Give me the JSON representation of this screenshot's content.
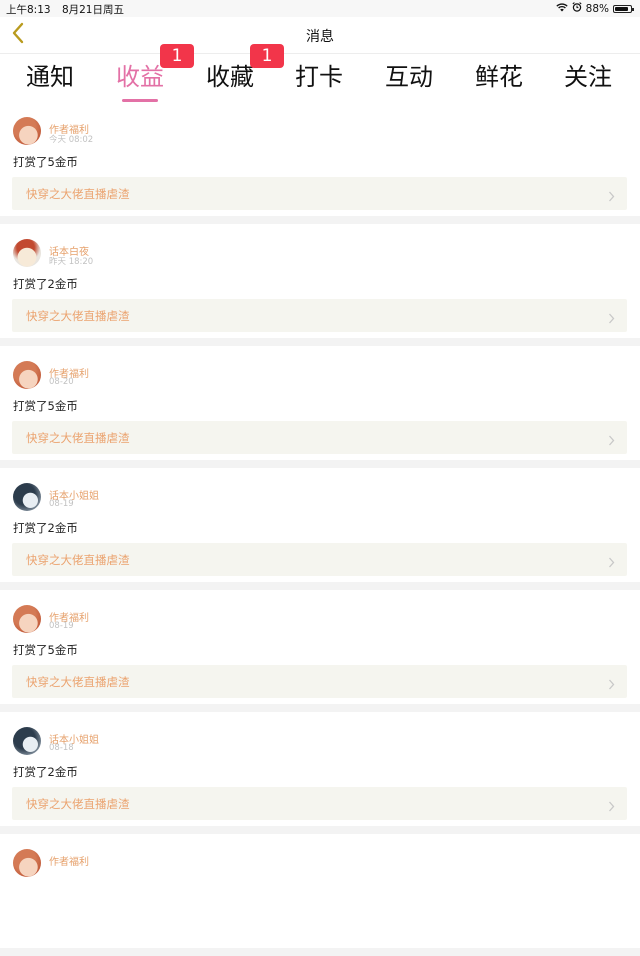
{
  "status_bar": {
    "time": "上午8:13",
    "date": "8月21日周五",
    "battery_pct": "88%",
    "battery_level": 0.88
  },
  "nav": {
    "title": "消息",
    "back_icon": "chevron-left-icon"
  },
  "tabs": [
    {
      "label": "通知",
      "active": false,
      "badge": ""
    },
    {
      "label": "收益",
      "active": true,
      "badge": "1"
    },
    {
      "label": "收藏",
      "active": false,
      "badge": "1"
    },
    {
      "label": "打卡",
      "active": false,
      "badge": ""
    },
    {
      "label": "互动",
      "active": false,
      "badge": ""
    },
    {
      "label": "鲜花",
      "active": false,
      "badge": ""
    },
    {
      "label": "关注",
      "active": false,
      "badge": ""
    }
  ],
  "feed": [
    {
      "user": "作者福利",
      "time": "今天 08:02",
      "reward": "打赏了5金币",
      "book": "快穿之大佬直播虐渣"
    },
    {
      "user": "话本白夜",
      "time": "昨天 18:20",
      "reward": "打赏了2金币",
      "book": "快穿之大佬直播虐渣"
    },
    {
      "user": "作者福利",
      "time": "08-20",
      "reward": "打赏了5金币",
      "book": "快穿之大佬直播虐渣"
    },
    {
      "user": "话本小姐姐",
      "time": "08-19",
      "reward": "打赏了2金币",
      "book": "快穿之大佬直播虐渣"
    },
    {
      "user": "作者福利",
      "time": "08-19",
      "reward": "打赏了5金币",
      "book": "快穿之大佬直播虐渣"
    },
    {
      "user": "话本小姐姐",
      "time": "08-18",
      "reward": "打赏了2金币",
      "book": "快穿之大佬直播虐渣"
    },
    {
      "user": "作者福利",
      "time": "",
      "reward": "",
      "book": ""
    }
  ],
  "colors": {
    "accent_pink": "#e371a6",
    "badge_red": "#f2354a",
    "name_orange": "#e6a16c",
    "book_orange": "#eba36f",
    "back_arrow": "#b99b1e"
  }
}
